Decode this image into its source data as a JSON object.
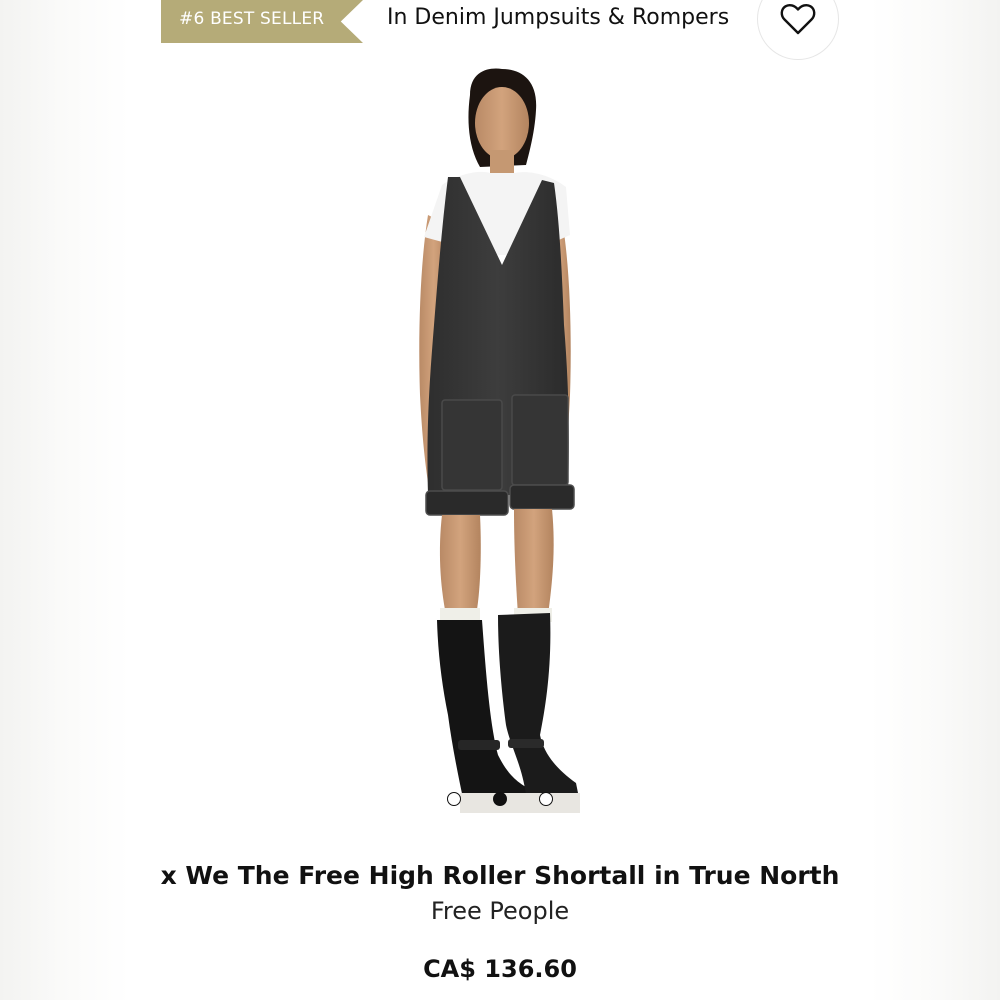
{
  "badge": {
    "label": "#6 BEST SELLER",
    "color": "#b5ab78"
  },
  "category": {
    "label": "In Denim Jumpsuits & Rompers"
  },
  "favorite": {
    "icon": "heart-outline-icon"
  },
  "gallery": {
    "image": "model-wearing-black-denim-shortall-with-knee-high-boots",
    "slide_count": 3,
    "active_slide": 2
  },
  "product": {
    "title": "x We The Free High Roller Shortall in True North",
    "brand": "Free People",
    "price": "CA$ 136.60"
  }
}
